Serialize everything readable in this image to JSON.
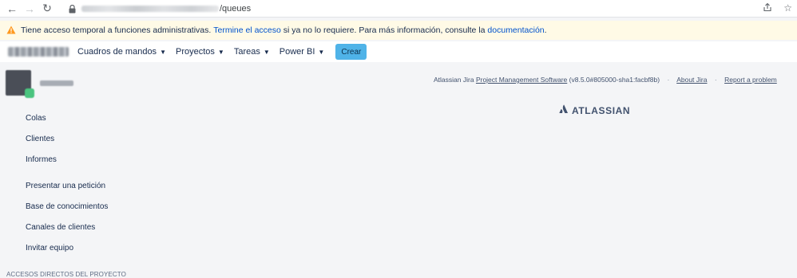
{
  "browser": {
    "url_path": "/queues"
  },
  "banner": {
    "text_before": "Tiene acceso temporal a funciones administrativas.",
    "link_end": "Termine el acceso",
    "text_middle": "si ya no lo requiere. Para más información, consulte la",
    "link_docs": "documentación",
    "text_after": "."
  },
  "header": {
    "menu": [
      {
        "label": "Cuadros de mandos"
      },
      {
        "label": "Proyectos"
      },
      {
        "label": "Tareas"
      },
      {
        "label": "Power BI"
      }
    ],
    "create_label": "Crear"
  },
  "sidebar": {
    "items_primary": [
      {
        "label": "Colas"
      },
      {
        "label": "Clientes"
      },
      {
        "label": "Informes"
      }
    ],
    "items_secondary": [
      {
        "label": "Presentar una petición"
      },
      {
        "label": "Base de conocimientos"
      },
      {
        "label": "Canales de clientes"
      },
      {
        "label": "Invitar equipo"
      }
    ],
    "section_title": "ACCESOS DIRECTOS DEL PROYECTO"
  },
  "footer": {
    "prefix": "Atlassian Jira",
    "pm_link": "Project Management Software",
    "version": "(v8.5.0#805000-sha1:facbf8b)",
    "separator": "·",
    "about": "About Jira",
    "report": "Report a problem",
    "logo_text": "ATLASSIAN"
  },
  "colors": {
    "accent": "#0052cc",
    "create_button": "#4fb3e8",
    "banner_bg": "#fffae6",
    "page_bg": "#f4f5f7"
  }
}
